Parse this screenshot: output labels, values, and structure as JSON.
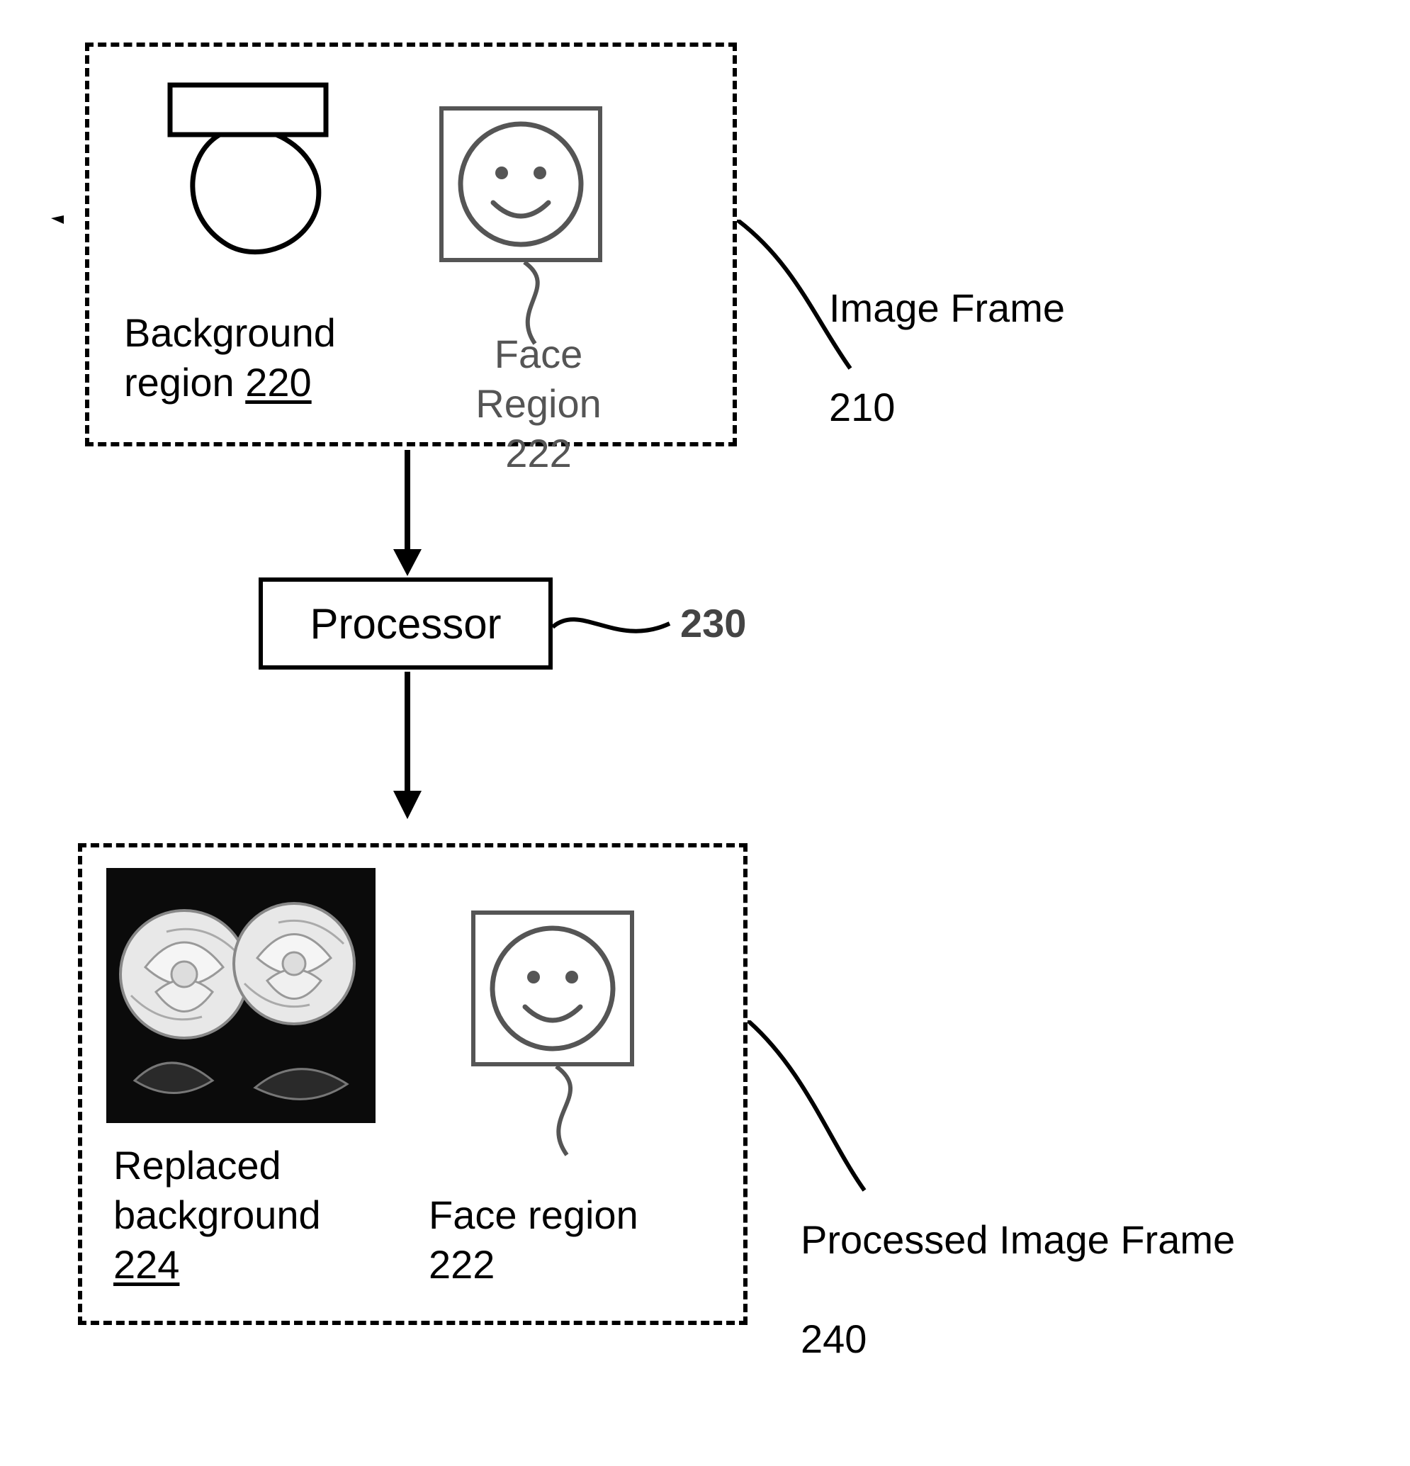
{
  "imageFrame": {
    "label_line1": "Image Frame",
    "label_line2": "210",
    "background": {
      "label_line1": "Background",
      "label_line2_prefix": "region ",
      "ref": "220"
    },
    "face": {
      "label_line1": "Face Region",
      "label_line2": "222"
    }
  },
  "processor": {
    "label": "Processor",
    "ref": "230"
  },
  "processedFrame": {
    "label_line1": "Processed Image Frame",
    "label_line2": "240",
    "replaced_bg": {
      "label_line1": "Replaced",
      "label_line2": "background",
      "ref": "224"
    },
    "face": {
      "label_line1": "Face region",
      "label_line2": "222"
    }
  }
}
